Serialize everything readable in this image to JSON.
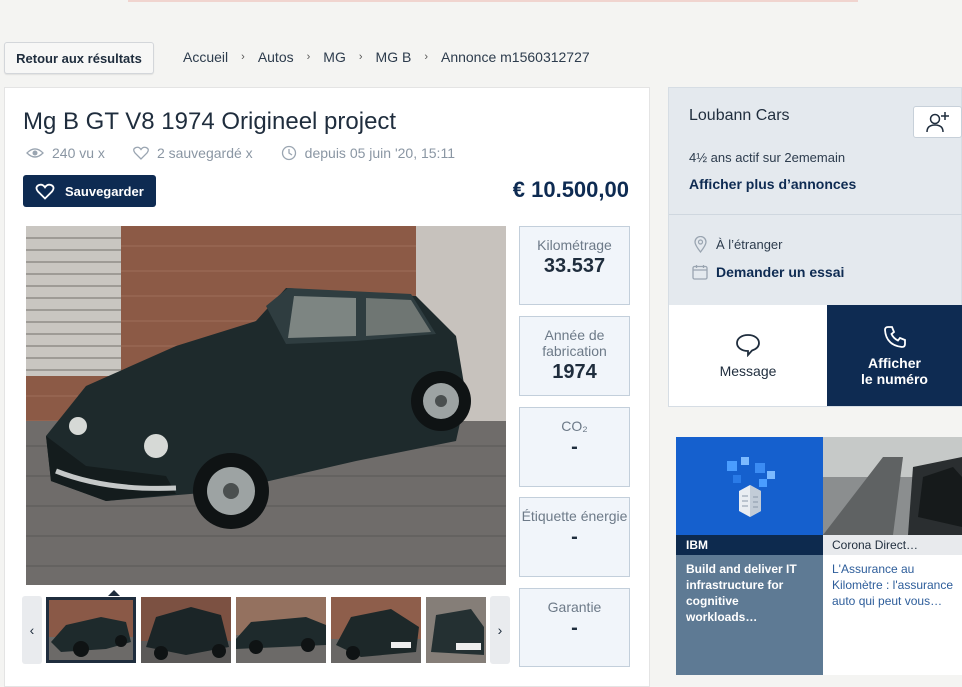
{
  "nav": {
    "back_label": "Retour aux résultats",
    "breadcrumb": [
      "Accueil",
      "Autos",
      "MG",
      "MG B",
      "Annonce m1560312727"
    ]
  },
  "listing": {
    "title": "Mg B GT V8 1974 Origineel project",
    "views": "240 vu x",
    "saved": "2 sauvegardé x",
    "since": "depuis 05 juin '20, 15:11",
    "save_label": "Sauvegarder",
    "price": "€ 10.500,00",
    "specs": [
      {
        "label": "Kilométrage",
        "value": "33.537"
      },
      {
        "label": "Année de fabrication",
        "value": "1974"
      },
      {
        "label": "CO₂",
        "value": "-"
      },
      {
        "label": "Étiquette énergie",
        "value": "-"
      },
      {
        "label": "Garantie",
        "value": "-"
      }
    ],
    "thumbnail_count": 5
  },
  "seller": {
    "name": "Loubann Cars",
    "active": "4½ ans actif sur 2ememain",
    "more_link": "Afficher plus d’annonces",
    "location": "À l’étranger",
    "trial": "Demander un essai",
    "message_label": "Message",
    "call_label_1": "Afficher",
    "call_label_2": "le numéro"
  },
  "ads": [
    {
      "brand": "IBM",
      "text": "Build and deliver IT infrastructure for cognitive workloads…"
    },
    {
      "brand": "Corona Direct…",
      "text_line1": "L'Assurance au",
      "text_line2": "Kilomètre : l'assurance",
      "text_line3": "auto qui peut vous…"
    }
  ],
  "colors": {
    "brand_navy": "#0e2b52",
    "seller_panel": "#e4e9ee",
    "ibm_blue": "#1560ce"
  }
}
